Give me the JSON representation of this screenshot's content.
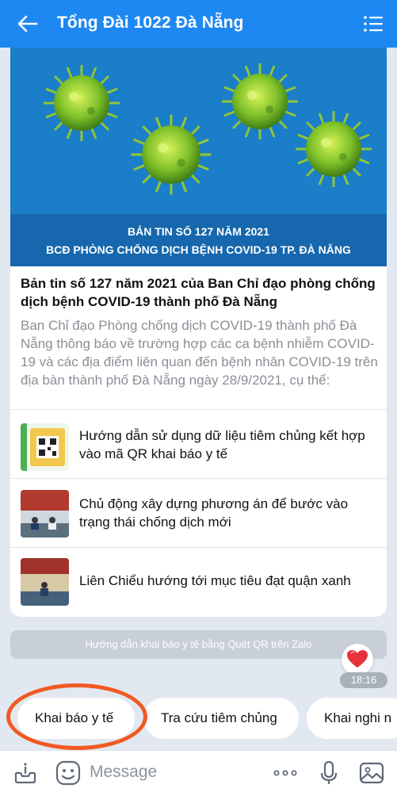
{
  "header": {
    "title": "Tổng Đài 1022 Đà Nẵng"
  },
  "article": {
    "banner_line1": "BẢN TIN SỐ 127 NĂM 2021",
    "banner_line2": "BCĐ PHÒNG CHỐNG DỊCH BỆNH COVID-19 TP. ĐÀ NẴNG",
    "headline": "Bản tin số 127 năm 2021 của Ban Chỉ đạo phòng chống dịch bệnh COVID-19 thành phố Đà Nẵng",
    "summary": "Ban Chỉ đạo Phòng chống dịch COVID-19 thành phố Đà Nẵng thông báo về trường hợp các ca bệnh nhiễm COVID-19 và các địa điểm liên quan đến bệnh nhân COVID-19 trên địa bàn thành phố Đà Nẵng ngày 28/9/2021, cụ thể:",
    "related": [
      {
        "title": "Hướng dẫn sử dụng dữ liệu tiêm chủng kết hợp vào mã QR khai báo y tế"
      },
      {
        "title": "Chủ động xây dựng phương án để bước vào trạng thái chống dịch mới"
      },
      {
        "title": "Liên Chiểu hướng tới mục tiêu đạt quận xanh"
      }
    ]
  },
  "notice": "Hướng dẫn khai báo y tế bằng Quét QR trên Zalo",
  "message_time": "18:16",
  "quick_replies": [
    "Khai báo y tế",
    "Tra cứu tiêm chủng",
    "Khai nghi n"
  ],
  "composer": {
    "placeholder": "Message"
  },
  "colors": {
    "header_blue": "#1e88f2",
    "highlight_ring": "#f05a22",
    "chat_background": "#e2e8f0"
  },
  "icons": [
    "back-arrow-icon",
    "list-menu-icon",
    "heart-reaction-icon",
    "info-tray-icon",
    "sticker-face-icon",
    "more-dots-icon",
    "microphone-icon",
    "image-gallery-icon"
  ]
}
